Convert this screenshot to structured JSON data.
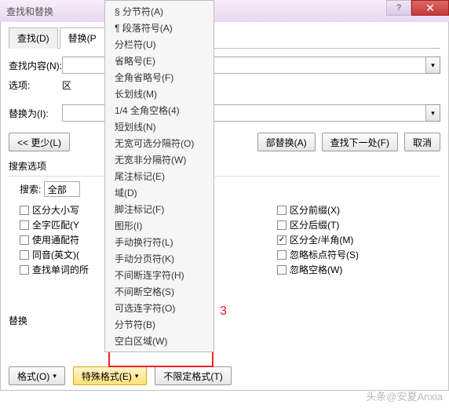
{
  "titlebar": {
    "title": "查找和替换"
  },
  "tabs": {
    "find": "查找(D)",
    "replace": "替换(P"
  },
  "labels": {
    "findwhat": "查找内容(N):",
    "options": "选项:",
    "optionsval": "区",
    "replacewith": "替换为(I):"
  },
  "buttons": {
    "less": "<< 更少(L)",
    "replaceall": "部替换(A)",
    "findnext": "查找下一处(F)",
    "cancel": "取消",
    "format": "格式(O)",
    "special": "特殊格式(E)",
    "noformat": "不限定格式(T)"
  },
  "sections": {
    "searchopt": "搜索选项",
    "search": "搜索:",
    "searchval": "全部",
    "replaceheading": "替换"
  },
  "checksL": [
    "区分大小写",
    "全字匹配(Y",
    "使用通配符",
    "同音(英文)(",
    "查找单词的所"
  ],
  "checksR": [
    {
      "label": "区分前缀(X)",
      "checked": false
    },
    {
      "label": "区分后缀(T)",
      "checked": false
    },
    {
      "label": "区分全/半角(M)",
      "checked": true
    },
    {
      "label": "忽略标点符号(S)",
      "checked": false
    },
    {
      "label": "忽略空格(W)",
      "checked": false
    }
  ],
  "popup": [
    "§ 分节符(A)",
    "¶ 段落符号(A)",
    "分栏符(U)",
    "省略号(E)",
    "全角省略号(F)",
    "长划线(M)",
    "1/4 全角空格(4)",
    "短划线(N)",
    "无宽可选分隔符(O)",
    "无宽非分隔符(W)",
    "尾注标记(E)",
    "域(D)",
    "脚注标记(F)",
    "图形(I)",
    "手动换行符(L)",
    "手动分页符(K)",
    "不间断连字符(H)",
    "不间断空格(S)",
    "可选连字符(O)",
    "分节符(B)",
    "空白区域(W)"
  ],
  "annotation": "3",
  "watermark": "头条@安夏Anxia"
}
